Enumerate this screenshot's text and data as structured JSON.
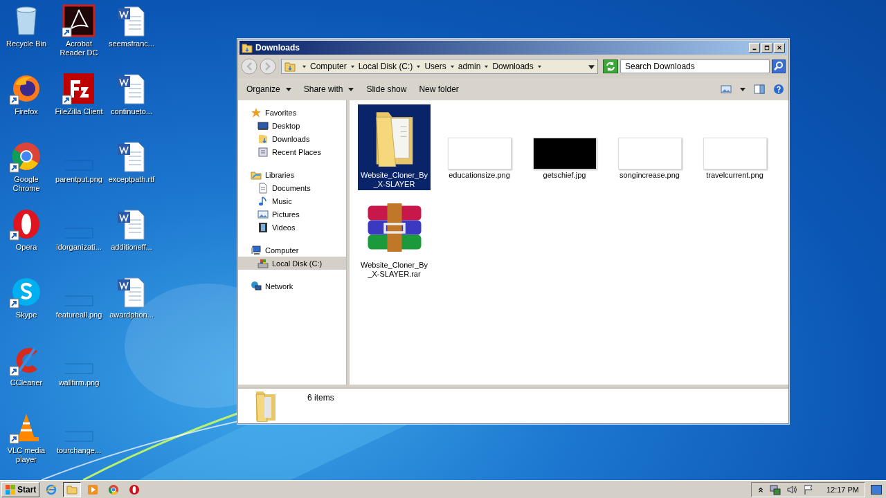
{
  "desktop_icons": [
    {
      "label": "Recycle Bin",
      "kind": "recycle",
      "shortcut": false
    },
    {
      "label": "Firefox",
      "kind": "firefox",
      "shortcut": true
    },
    {
      "label": "Google Chrome",
      "kind": "chrome",
      "shortcut": true
    },
    {
      "label": "Opera",
      "kind": "opera",
      "shortcut": true
    },
    {
      "label": "Skype",
      "kind": "skype",
      "shortcut": true
    },
    {
      "label": "CCleaner",
      "kind": "ccleaner",
      "shortcut": true
    },
    {
      "label": "VLC media player",
      "kind": "vlc",
      "shortcut": true
    },
    {
      "label": "Acrobat Reader DC",
      "kind": "acrobat",
      "shortcut": true
    },
    {
      "label": "FileZilla Client",
      "kind": "filezilla",
      "shortcut": true
    },
    {
      "label": "parentput.png",
      "kind": "image",
      "shortcut": false
    },
    {
      "label": "idorganizati...",
      "kind": "image",
      "shortcut": false
    },
    {
      "label": "featureall.png",
      "kind": "image",
      "shortcut": false
    },
    {
      "label": "wallfirm.png",
      "kind": "image",
      "shortcut": false
    },
    {
      "label": "tourchange...",
      "kind": "image",
      "shortcut": false
    },
    {
      "label": "seemsfranc...",
      "kind": "word",
      "shortcut": false
    },
    {
      "label": "continueto...",
      "kind": "word",
      "shortcut": false
    },
    {
      "label": "exceptpath.rtf",
      "kind": "word",
      "shortcut": false
    },
    {
      "label": "additioneff...",
      "kind": "word",
      "shortcut": false
    },
    {
      "label": "awardphon...",
      "kind": "word",
      "shortcut": false
    }
  ],
  "window": {
    "title": "Downloads",
    "breadcrumb": [
      "Computer",
      "Local Disk (C:)",
      "Users",
      "admin",
      "Downloads"
    ],
    "search": {
      "placeholder": "Search Downloads"
    },
    "toolbar": [
      {
        "label": "Organize",
        "dropdown": true
      },
      {
        "label": "Share with",
        "dropdown": true
      },
      {
        "label": "Slide show",
        "dropdown": false
      },
      {
        "label": "New folder",
        "dropdown": false
      }
    ],
    "nav": [
      {
        "label": "Favorites",
        "kind": "star",
        "selected": false,
        "children": [
          {
            "label": "Desktop",
            "kind": "desktop",
            "selected": false
          },
          {
            "label": "Downloads",
            "kind": "downloads",
            "selected": false
          },
          {
            "label": "Recent Places",
            "kind": "recent",
            "selected": false
          }
        ]
      },
      {
        "label": "Libraries",
        "kind": "library",
        "selected": false,
        "children": [
          {
            "label": "Documents",
            "kind": "document",
            "selected": false
          },
          {
            "label": "Music",
            "kind": "music",
            "selected": false
          },
          {
            "label": "Pictures",
            "kind": "pictures",
            "selected": false
          },
          {
            "label": "Videos",
            "kind": "videos",
            "selected": false
          }
        ]
      },
      {
        "label": "Computer",
        "kind": "computer",
        "selected": false,
        "children": [
          {
            "label": "Local Disk (C:)",
            "kind": "disk",
            "selected": true
          }
        ]
      },
      {
        "label": "Network",
        "kind": "network",
        "selected": false
      }
    ],
    "files": [
      {
        "name": "Website_Cloner_By_X-SLAYER",
        "kind": "folder",
        "selected": true
      },
      {
        "name": "educationsize.png",
        "kind": "image",
        "color": "#ffffff",
        "selected": false
      },
      {
        "name": "getschief.jpg",
        "kind": "image",
        "color": "#000000",
        "selected": false
      },
      {
        "name": "songincrease.png",
        "kind": "image",
        "color": "#ffffff",
        "selected": false
      },
      {
        "name": "travelcurrent.png",
        "kind": "image",
        "color": "#ffffff",
        "selected": false
      },
      {
        "name": "Website_Cloner_By_X-SLAYER.rar",
        "kind": "archive",
        "selected": false
      }
    ],
    "status": "6 items"
  },
  "taskbar": {
    "start": "Start",
    "apps": [
      {
        "kind": "ie",
        "selected": false
      },
      {
        "kind": "explorer",
        "selected": true
      },
      {
        "kind": "media",
        "selected": false
      },
      {
        "kind": "chrome",
        "selected": false
      },
      {
        "kind": "opera",
        "selected": false
      }
    ],
    "clock": "12:17 PM"
  }
}
